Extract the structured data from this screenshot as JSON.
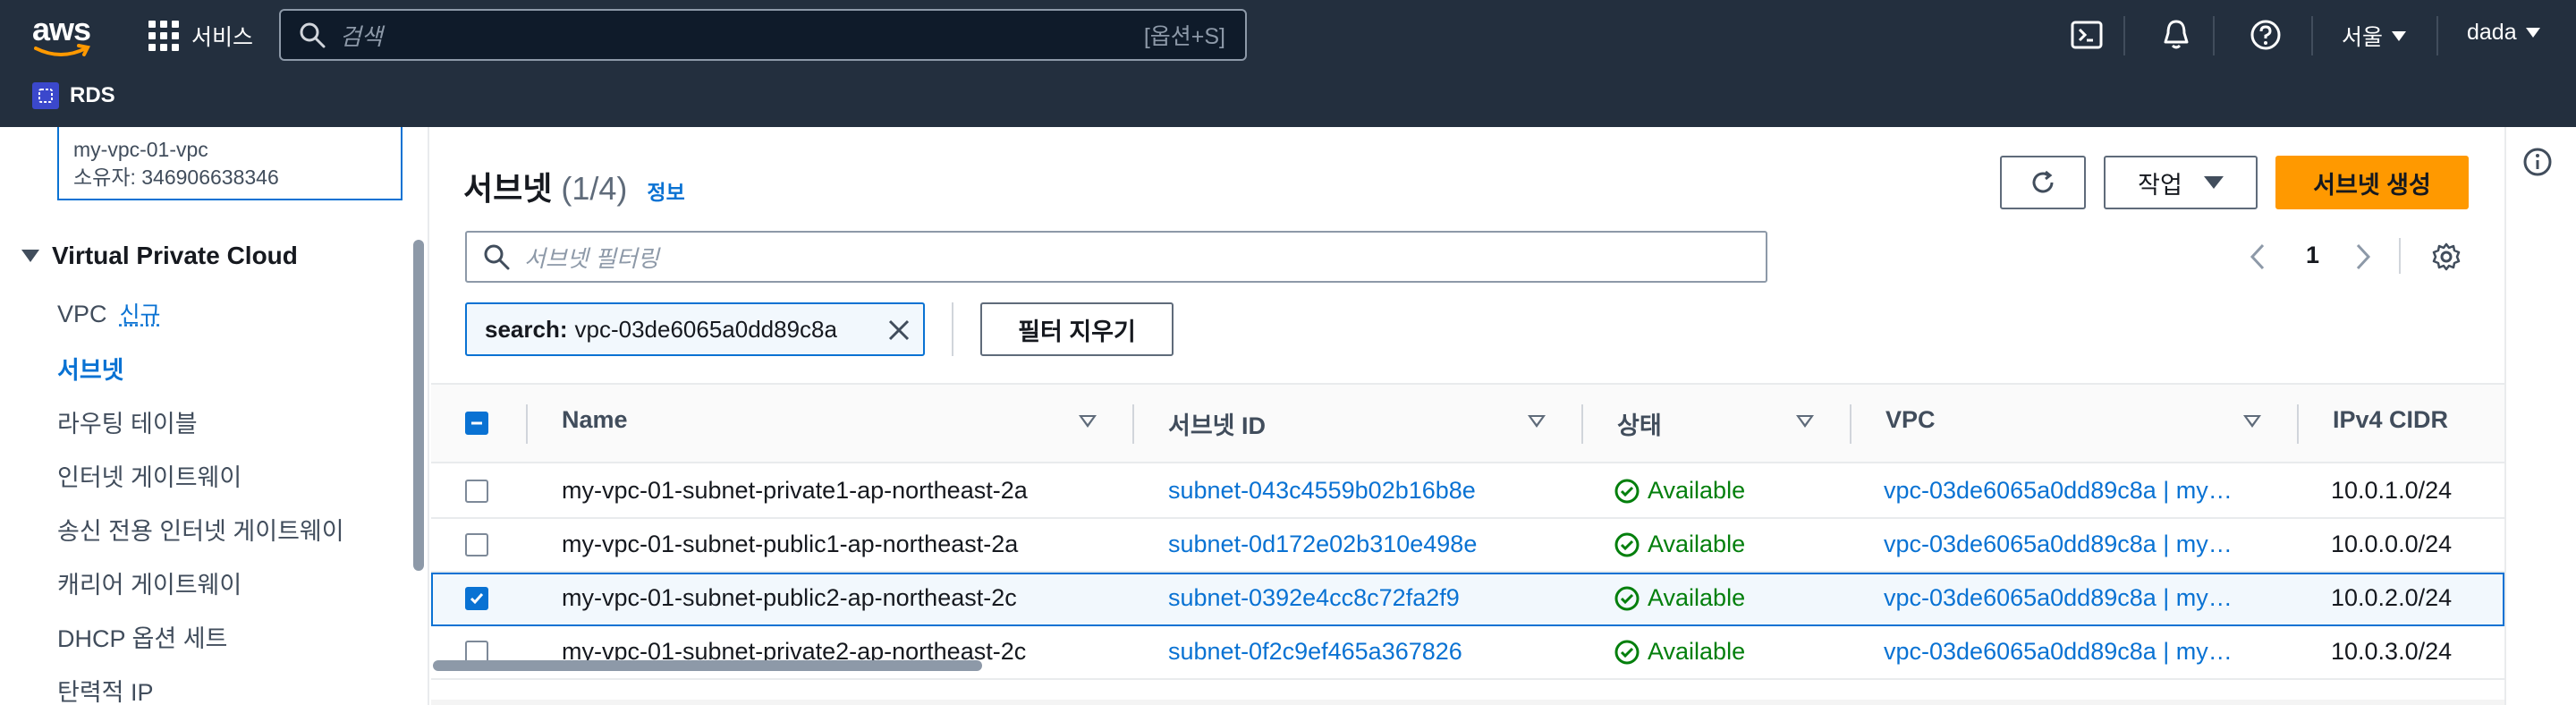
{
  "nav": {
    "logo": "aws",
    "services_label": "서비스",
    "search_placeholder": "검색",
    "search_shortcut": "[옵션+S]",
    "region": "서울",
    "user": "dada",
    "icons": [
      "cloudshell-icon",
      "bell-icon",
      "help-icon"
    ]
  },
  "service_bar": {
    "label": "RDS"
  },
  "sidebar": {
    "vpc_card": {
      "name": "my-vpc-01-vpc",
      "owner": "소유자: 346906638346"
    },
    "section_title": "Virtual Private Cloud",
    "items": [
      {
        "label": "VPC",
        "badge": "신규"
      },
      {
        "label": "서브넷",
        "active": true
      },
      {
        "label": "라우팅 테이블"
      },
      {
        "label": "인터넷 게이트웨이"
      },
      {
        "label": "송신 전용 인터넷 게이트웨이"
      },
      {
        "label": "캐리어 게이트웨이"
      },
      {
        "label": "DHCP 옵션 세트"
      },
      {
        "label": "탄력적 IP"
      }
    ]
  },
  "panel": {
    "title": "서브넷",
    "count": "(1/4)",
    "info": "정보",
    "actions_label": "작업",
    "create_label": "서브넷 생성",
    "filter_placeholder": "서브넷 필터링",
    "page": "1",
    "token_key": "search:",
    "token_value": "vpc-03de6065a0dd89c8a",
    "clear_label": "필터 지우기"
  },
  "table": {
    "columns": [
      "Name",
      "서브넷 ID",
      "상태",
      "VPC",
      "IPv4 CIDR"
    ],
    "rows": [
      {
        "checked": false,
        "name": "my-vpc-01-subnet-private1-ap-northeast-2a",
        "subnet_id": "subnet-043c4559b02b16b8e",
        "status": "Available",
        "vpc": "vpc-03de6065a0dd89c8a | my…",
        "cidr": "10.0.1.0/24"
      },
      {
        "checked": false,
        "name": "my-vpc-01-subnet-public1-ap-northeast-2a",
        "subnet_id": "subnet-0d172e02b310e498e",
        "status": "Available",
        "vpc": "vpc-03de6065a0dd89c8a | my…",
        "cidr": "10.0.0.0/24"
      },
      {
        "checked": true,
        "name": "my-vpc-01-subnet-public2-ap-northeast-2c",
        "subnet_id": "subnet-0392e4cc8c72fa2f9",
        "status": "Available",
        "vpc": "vpc-03de6065a0dd89c8a | my…",
        "cidr": "10.0.2.0/24"
      },
      {
        "checked": false,
        "name": "my-vpc-01-subnet-private2-ap-northeast-2c",
        "subnet_id": "subnet-0f2c9ef465a367826",
        "status": "Available",
        "vpc": "vpc-03de6065a0dd89c8a | my…",
        "cidr": "10.0.3.0/24"
      }
    ]
  },
  "colors": {
    "nav_bg": "#232f3e",
    "link": "#0972d3",
    "primary": "#ff9900",
    "success": "#037f0c"
  }
}
